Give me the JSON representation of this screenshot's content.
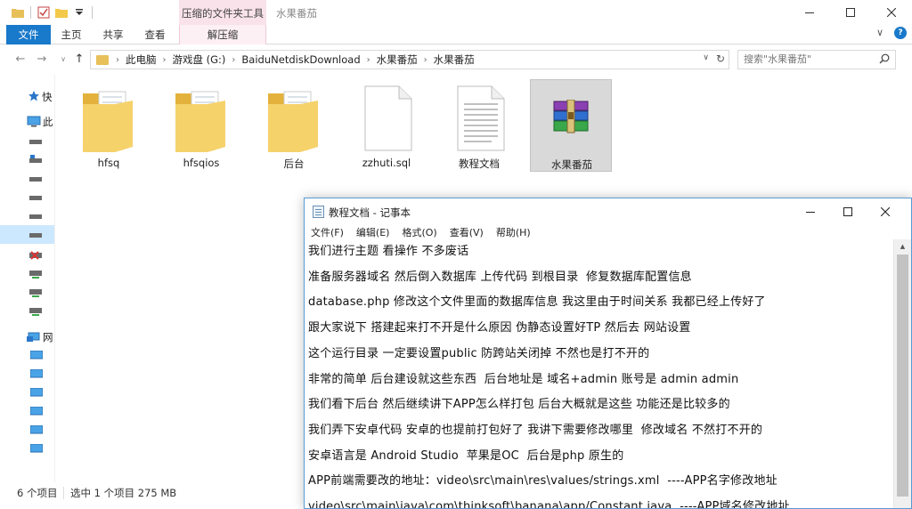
{
  "explorer": {
    "window_title": "水果番茄",
    "context_tab_title": "压缩的文件夹工具",
    "ribbon_tabs": {
      "file": "文件",
      "home": "主页",
      "share": "共享",
      "view": "查看",
      "context": "解压缩"
    },
    "address": {
      "crumbs": [
        "此电脑",
        "游戏盘 (G:)",
        "BaiduNetdiskDownload",
        "水果番茄",
        "水果番茄"
      ]
    },
    "search": {
      "placeholder": "搜索\"水果番茄\""
    },
    "nav_pane": {
      "quick_access": "快",
      "this_pc": "此",
      "network": "网"
    },
    "items": [
      {
        "name": "hfsq",
        "type": "folder"
      },
      {
        "name": "hfsqios",
        "type": "folder"
      },
      {
        "name": "后台",
        "type": "folder"
      },
      {
        "name": "zzhuti.sql",
        "type": "file"
      },
      {
        "name": "教程文档",
        "type": "text"
      },
      {
        "name": "水果番茄",
        "type": "archive",
        "selected": true
      }
    ],
    "status": {
      "count": "6 个项目",
      "selection": "选中 1 个项目  275 MB"
    }
  },
  "notepad": {
    "title": "教程文档 - 记事本",
    "menu": {
      "file": "文件(F)",
      "edit": "编辑(E)",
      "format": "格式(O)",
      "view": "查看(V)",
      "help": "帮助(H)"
    },
    "lines": [
      "我们进行主题 看操作 不多废话",
      "准备服务器域名 然后倒入数据库 上传代码 到根目录  修复数据库配置信息",
      "database.php 修改这个文件里面的数据库信息 我这里由于时间关系 我都已经上传好了",
      "跟大家说下 搭建起来打不开是什么原因 伪静态设置好TP 然后去 网站设置",
      "这个运行目录 一定要设置public 防跨站关闭掉 不然也是打不开的",
      "非常的简单 后台建设就这些东西  后台地址是 域名+admin 账号是 admin admin",
      "我们看下后台 然后继续讲下APP怎么样打包 后台大概就是这些 功能还是比较多的",
      "我们弄下安卓代码 安卓的也提前打包好了 我讲下需要修改哪里  修改域名 不然打不开的",
      "安卓语言是 Android Studio  苹果是OC  后台是php 原生的",
      "APP前端需要改的地址：video\\src\\main\\res\\values/strings.xml  ----APP名字修改地址",
      "video\\src\\main\\java\\com\\thinksoft\\banana\\app/Constant.java  ----APP域名修改地址"
    ]
  },
  "colors": {
    "accent": "#1979ca",
    "context_tab": "#f9e2ea",
    "folder": "#f3c94a",
    "selection": "#d9d9d9"
  }
}
